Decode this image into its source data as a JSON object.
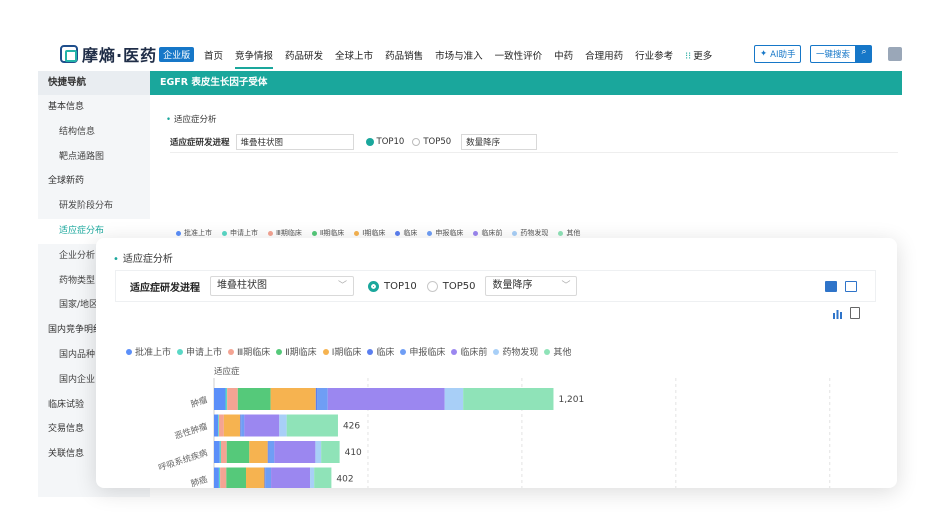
{
  "header": {
    "brand": "摩熵·医药",
    "brand_badge": "企业版",
    "nav": [
      "首页",
      "竞争情报",
      "药品研发",
      "全球上市",
      "药品销售",
      "市场与准入",
      "一致性评价",
      "中药",
      "合理用药",
      "行业参考"
    ],
    "nav_active_index": 1,
    "more": "更多",
    "ai_button": "AI助手",
    "search_button": "一键搜索"
  },
  "sidebar": {
    "title": "快捷导航",
    "items": [
      {
        "label": "基本信息",
        "sub": false
      },
      {
        "label": "结构信息",
        "sub": true
      },
      {
        "label": "靶点通路图",
        "sub": true
      },
      {
        "label": "全球新药",
        "sub": false
      },
      {
        "label": "研发阶段分布",
        "sub": true
      },
      {
        "label": "适应症分布",
        "sub": true,
        "active": true
      },
      {
        "label": "企业分析",
        "sub": true
      },
      {
        "label": "药物类型",
        "sub": true
      },
      {
        "label": "国家/地区",
        "sub": true
      },
      {
        "label": "国内竞争明细",
        "sub": false
      },
      {
        "label": "国内品种",
        "sub": true
      },
      {
        "label": "国内企业",
        "sub": true
      },
      {
        "label": "临床试验",
        "sub": false
      },
      {
        "label": "交易信息",
        "sub": false
      },
      {
        "label": "关联信息",
        "sub": false
      }
    ]
  },
  "target_bar": {
    "title": "EGFR  表皮生长因子受体"
  },
  "panel": {
    "section_title": "适应症分析",
    "toolbar": {
      "label": "适应症研发进程",
      "chart_type_value": "堆叠柱状图",
      "top10": "TOP10",
      "top50": "TOP50",
      "sort_value": "数量降序",
      "top10_selected": true
    }
  },
  "colors": {
    "accent": "#1aa79c",
    "brand_blue": "#1677c8"
  },
  "chart_data": {
    "type": "bar",
    "orientation": "horizontal",
    "stacked": true,
    "ylabel": "适应症",
    "categories": [
      "肿瘤",
      "恶性肿瘤",
      "呼吸系统疾病",
      "肺癌"
    ],
    "totals": [
      1201,
      426,
      410,
      402
    ],
    "xlim": [
      0,
      1500
    ],
    "grid": true,
    "legend_position": "top-left",
    "series": [
      {
        "name": "批准上市",
        "color": "#5b8ff9",
        "values": [
          28,
          10,
          14,
          12
        ]
      },
      {
        "name": "申请上市",
        "color": "#5ad8c6",
        "values": [
          4,
          2,
          3,
          3
        ]
      },
      {
        "name": "Ⅲ期临床",
        "color": "#f4a493",
        "values": [
          26,
          12,
          14,
          15
        ]
      },
      {
        "name": "Ⅱ期临床",
        "color": "#55c97a",
        "values": [
          80,
          0,
          55,
          48
        ]
      },
      {
        "name": "Ⅰ期临床",
        "color": "#f6b350",
        "values": [
          110,
          40,
          45,
          45
        ]
      },
      {
        "name": "临床",
        "color": "#5b7ff0",
        "values": [
          3,
          2,
          2,
          2
        ]
      },
      {
        "name": "申报临床",
        "color": "#6f9ef5",
        "values": [
          26,
          8,
          14,
          14
        ]
      },
      {
        "name": "临床前",
        "color": "#9b87f0",
        "values": [
          285,
          85,
          100,
          95
        ]
      },
      {
        "name": "药物发现",
        "color": "#a8cff7",
        "values": [
          45,
          18,
          14,
          10
        ]
      },
      {
        "name": "其他",
        "color": "#8fe3b8",
        "values": [
          220,
          125,
          45,
          42
        ]
      }
    ]
  }
}
